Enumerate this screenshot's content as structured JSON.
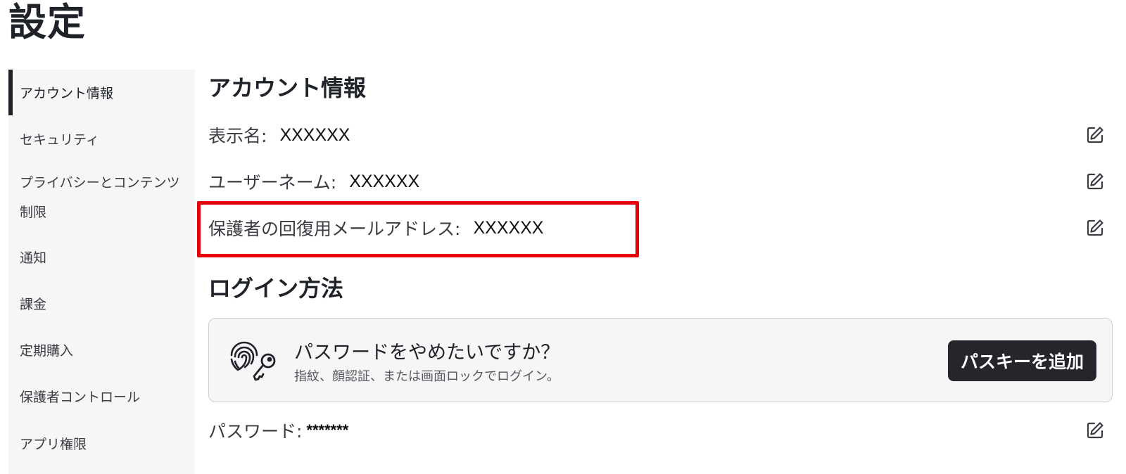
{
  "page": {
    "title": "設定"
  },
  "sidebar": {
    "items": [
      {
        "label": "アカウント情報",
        "active": true
      },
      {
        "label": "セキュリティ"
      },
      {
        "label_line1": "プライバシーとコンテンツ",
        "label_line2": "制限"
      },
      {
        "label": "通知"
      },
      {
        "label": "課金"
      },
      {
        "label": "定期購入"
      },
      {
        "label": "保護者コントロール"
      },
      {
        "label": "アプリ権限"
      }
    ]
  },
  "account_info": {
    "heading": "アカウント情報",
    "fields": [
      {
        "label": "表示名:",
        "value": "XXXXXX",
        "icon": "edit-icon"
      },
      {
        "label": "ユーザーネーム:",
        "value": "XXXXXX",
        "icon": "edit-icon"
      },
      {
        "label": "保護者の回復用メールアドレス:",
        "value": "XXXXXX",
        "icon": "edit-icon",
        "highlighted": true
      }
    ]
  },
  "login_methods": {
    "heading": "ログイン方法",
    "passkey_card": {
      "icon": "fingerprint-key-icon",
      "title": "パスワードをやめたいですか？",
      "subtitle": "指紋、顔認証、または画面ロックでログイン。",
      "button_label": "パスキーを追加"
    },
    "password": {
      "label": "パスワード:",
      "value": "*******",
      "icon": "edit-icon"
    }
  },
  "colors": {
    "highlight": "#e5000a",
    "button_bg": "#24262c",
    "sidebar_bg": "#f6f6f7"
  }
}
